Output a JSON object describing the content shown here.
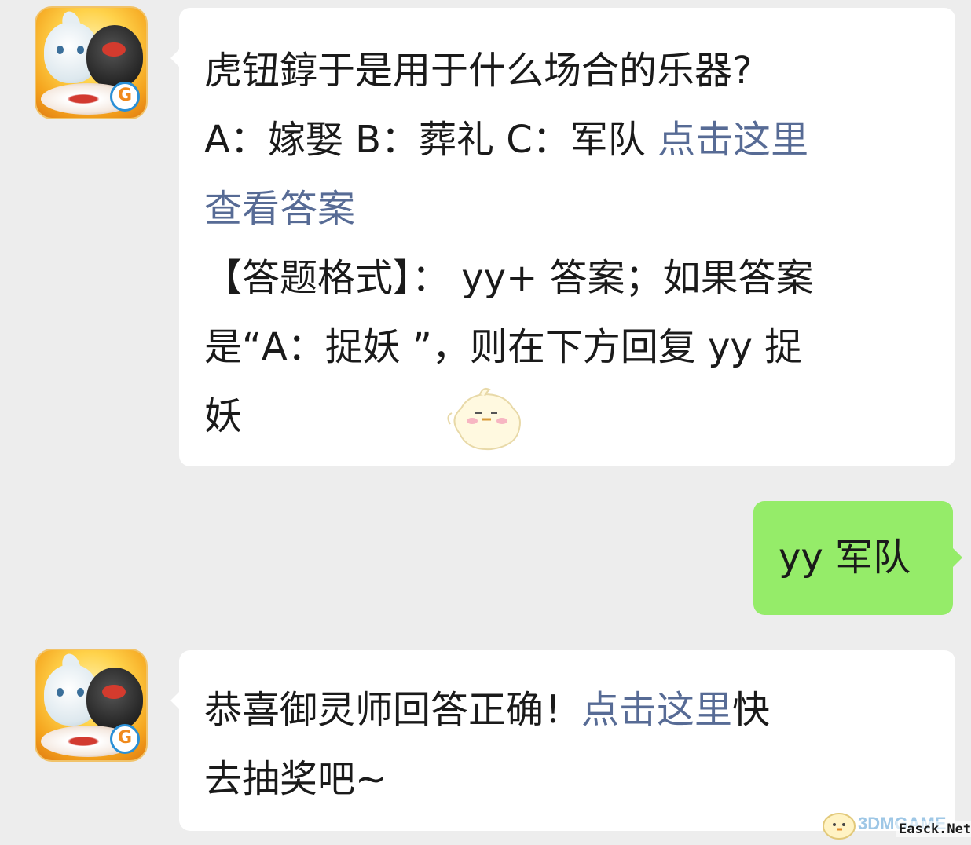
{
  "messages": [
    {
      "sender": "official-account",
      "question": "虎钮錞于是用于什么场合的乐器?",
      "options_text": "A：嫁娶 B：葬礼 C：军队 ",
      "link1": "点击这里",
      "link2": "查看答案",
      "format_line1": "【答题格式】：  yy+ 答案；如果答案",
      "format_line2": "是“A：捉妖 ”，则在下方回复 yy 捉",
      "format_line3": "妖"
    },
    {
      "sender": "me",
      "text": "yy 军队"
    },
    {
      "sender": "official-account",
      "text_before": "恭喜御灵师回答正确！",
      "link": "点击这里",
      "text_after": "快",
      "line2": "去抽奖吧~"
    }
  ],
  "watermark": {
    "brand": "3DMGAME",
    "site": "Easck.Net"
  },
  "colors": {
    "background": "#ededed",
    "bubble_incoming": "#ffffff",
    "bubble_outgoing": "#95ec69",
    "link": "#576b95"
  },
  "icons": {
    "avatar": "game-avatar-icon",
    "sticker": "chick-sticker-icon",
    "tencent_badge": "tencent-games-icon"
  }
}
